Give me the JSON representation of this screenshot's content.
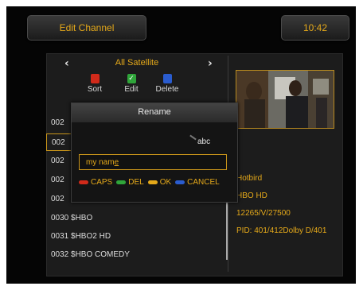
{
  "header": {
    "title": "Edit Channel",
    "clock": "10:42"
  },
  "satellite_bar": {
    "name": "All Satellite"
  },
  "function_keys": [
    {
      "label": "Sort",
      "color": "#d12a1a"
    },
    {
      "label": "Edit",
      "color": "#2fa53a"
    },
    {
      "label": "Delete",
      "color": "#2a5ccf"
    }
  ],
  "channel_list": [
    {
      "label": "002"
    },
    {
      "label": "002",
      "selected": true
    },
    {
      "label": "002"
    },
    {
      "label": "002"
    },
    {
      "label": "002"
    },
    {
      "label": "0030 $HBO"
    },
    {
      "label": "0031 $HBO2 HD"
    },
    {
      "label": "0032 $HBO COMEDY"
    }
  ],
  "channel_info": {
    "satellite": "Hotbird",
    "channel": "HBO HD",
    "frequency": "12265/V/27500",
    "pid": "PID: 401/412Dolby D/401"
  },
  "rename_dialog": {
    "title": "Rename",
    "input_mode": "abc",
    "input_value_before_cursor": "my nam",
    "input_value_cursor_char": "e",
    "actions": [
      {
        "label": "CAPS",
        "color": "#d12a1a"
      },
      {
        "label": "DEL",
        "color": "#2fa53a"
      },
      {
        "label": "OK",
        "color": "#e5a91a"
      },
      {
        "label": "CANCEL",
        "color": "#2a5ccf"
      }
    ]
  }
}
